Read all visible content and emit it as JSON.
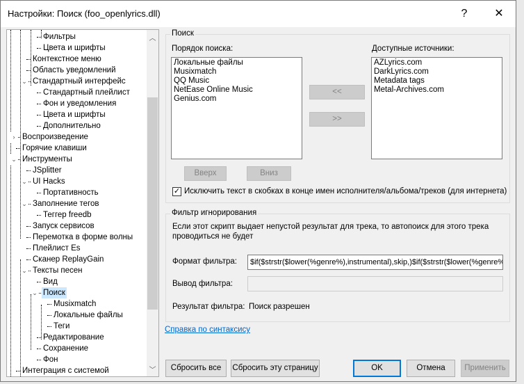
{
  "window": {
    "title": "Настройки: Поиск (foo_openlyrics.dll)",
    "help": "?",
    "close": "✕"
  },
  "tree": [
    {
      "label": "Фильтры",
      "level": 2,
      "exp": ""
    },
    {
      "label": "Цвета и шрифты",
      "level": 2,
      "exp": ""
    },
    {
      "label": "Контекстное меню",
      "level": 1,
      "exp": ""
    },
    {
      "label": "Область уведомлений",
      "level": 1,
      "exp": ""
    },
    {
      "label": "Стандартный интерфейс",
      "level": 1,
      "exp": "open"
    },
    {
      "label": "Стандартный плейлист",
      "level": 2,
      "exp": ""
    },
    {
      "label": "Фон и уведомления",
      "level": 2,
      "exp": ""
    },
    {
      "label": "Цвета и шрифты",
      "level": 2,
      "exp": ""
    },
    {
      "label": "Дополнительно",
      "level": 2,
      "exp": ""
    },
    {
      "label": "Воспроизведение",
      "level": 0,
      "exp": "closed"
    },
    {
      "label": "Горячие клавиши",
      "level": 0,
      "exp": ""
    },
    {
      "label": "Инструменты",
      "level": 0,
      "exp": "open"
    },
    {
      "label": "JSplitter",
      "level": 1,
      "exp": ""
    },
    {
      "label": "UI Hacks",
      "level": 1,
      "exp": "open"
    },
    {
      "label": "Портативность",
      "level": 2,
      "exp": ""
    },
    {
      "label": "Заполнение тегов",
      "level": 1,
      "exp": "open"
    },
    {
      "label": "Теггер freedb",
      "level": 2,
      "exp": ""
    },
    {
      "label": "Запуск сервисов",
      "level": 1,
      "exp": ""
    },
    {
      "label": "Перемотка в форме волны",
      "level": 1,
      "exp": ""
    },
    {
      "label": "Плейлист Es",
      "level": 1,
      "exp": ""
    },
    {
      "label": "Сканер ReplayGain",
      "level": 1,
      "exp": ""
    },
    {
      "label": "Тексты песен",
      "level": 1,
      "exp": "open"
    },
    {
      "label": "Вид",
      "level": 2,
      "exp": ""
    },
    {
      "label": "Поиск",
      "level": 2,
      "exp": "open",
      "selected": true
    },
    {
      "label": "Musixmatch",
      "level": 3,
      "exp": ""
    },
    {
      "label": "Локальные файлы",
      "level": 3,
      "exp": ""
    },
    {
      "label": "Теги",
      "level": 3,
      "exp": ""
    },
    {
      "label": "Редактирование",
      "level": 2,
      "exp": ""
    },
    {
      "label": "Сохранение",
      "level": 2,
      "exp": ""
    },
    {
      "label": "Фон",
      "level": 2,
      "exp": ""
    },
    {
      "label": "Интеграция с системой",
      "level": 0,
      "exp": ""
    }
  ],
  "search": {
    "group": "Поиск",
    "order_label": "Порядок поиска:",
    "order": [
      "Локальные файлы",
      "Musixmatch",
      "QQ Music",
      "NetEase Online Music",
      "Genius.com"
    ],
    "avail_label": "Доступные источники:",
    "avail": [
      "AZLyrics.com",
      "DarkLyrics.com",
      "Metadata tags",
      "Metal-Archives.com"
    ],
    "add": "<<",
    "remove": ">>",
    "up": "Вверх",
    "down": "Вниз",
    "exclude": "Исключить текст в скобках в конце имен исполнителя/альбома/треков (для интернета)",
    "exclude_checked": true
  },
  "filter": {
    "group": "Фильтр игнорирования",
    "desc1": "Если этот скрипт выдает непустой результат для трека, то автопоиск для этого трека",
    "desc2": "проводиться не будет",
    "format_label": "Формат фильтра:",
    "format_value": "$if($strstr($lower(%genre%),instrumental),skip,)$if($strstr($lower(%genre%),clas",
    "output_label": "Вывод фильтра:",
    "output_value": "",
    "result_label": "Результат фильтра:",
    "result_value": "Поиск разрешен"
  },
  "help_link": "Справка по синтаксису",
  "buttons": {
    "reset_all": "Сбросить все",
    "reset_page": "Сбросить эту страницу",
    "ok": "OK",
    "cancel": "Отмена",
    "apply": "Применить"
  }
}
